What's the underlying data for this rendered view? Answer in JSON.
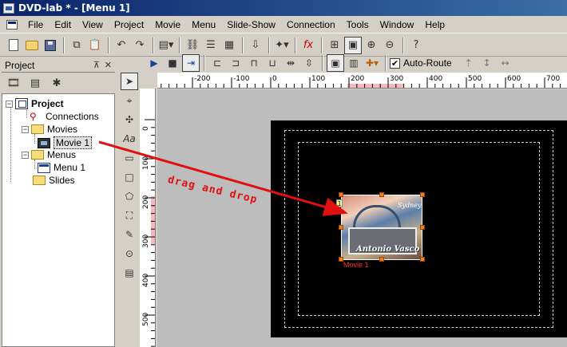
{
  "window": {
    "title": "DVD-lab * - [Menu 1]"
  },
  "menubar": [
    "File",
    "Edit",
    "View",
    "Project",
    "Movie",
    "Menu",
    "Slide-Show",
    "Connection",
    "Tools",
    "Window",
    "Help"
  ],
  "project_panel": {
    "title": "Project",
    "tree": {
      "root": "Project",
      "connections": "Connections",
      "movies_folder": "Movies",
      "movie_item": "Movie 1",
      "menus_folder": "Menus",
      "menu_item": "Menu 1",
      "slides_folder": "Slides"
    }
  },
  "toolbar2": {
    "auto_route_label": "Auto-Route",
    "auto_route_checked": true,
    "auto_route_check": "✔"
  },
  "rulers": {
    "horizontal_ticks": [
      "-200",
      "-100",
      "0",
      "100",
      "200",
      "300",
      "400",
      "500",
      "600",
      "700"
    ],
    "vertical_ticks": [
      "0",
      "100",
      "200",
      "300",
      "400",
      "500"
    ]
  },
  "canvas": {
    "thumb_index": "1",
    "thumb_caption": "Movie 1",
    "thumb_title_text": "Sydney",
    "thumb_card_text": "Antonio Vasco"
  },
  "annotation": {
    "text": "drag and drop",
    "color": "#e01010"
  },
  "colors": {
    "titlebar": "#0a246a",
    "menu_page": "#000000",
    "handles": "#f08018"
  }
}
